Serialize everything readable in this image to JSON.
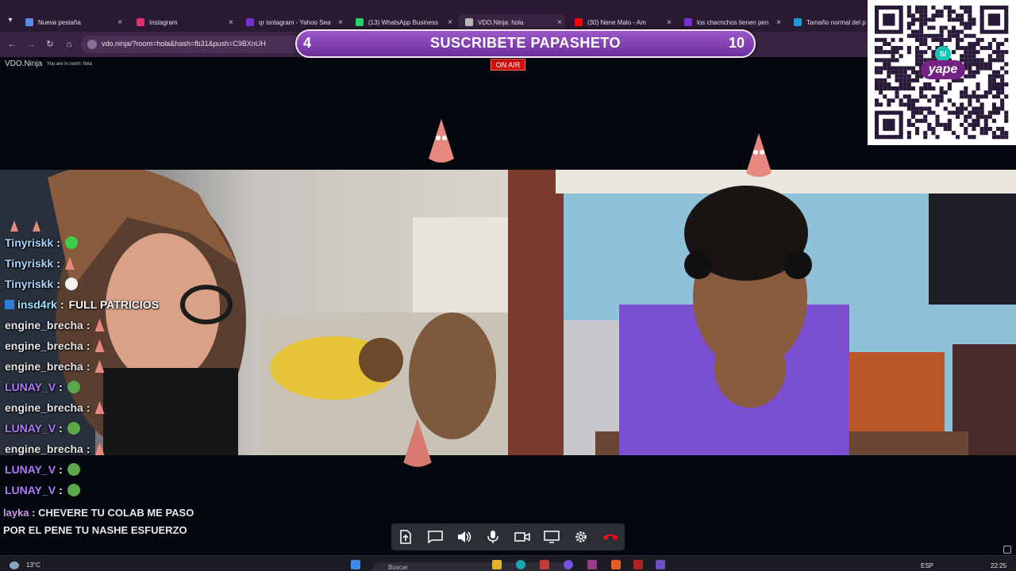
{
  "browser": {
    "tabs": [
      {
        "label": "Nueva pestaña",
        "favicon_color": "#5b8de6"
      },
      {
        "label": "Instagram",
        "favicon_color": "#e1306c"
      },
      {
        "label": "qr isntagram - Yahoo Sea",
        "favicon_color": "#7b2fd6"
      },
      {
        "label": "(13) WhatsApp Business",
        "favicon_color": "#25d366"
      },
      {
        "label": "VDO.Ninja: hola",
        "favicon_color": "#b8b8b8",
        "active": true
      },
      {
        "label": "(30) Nene Malo - Am",
        "favicon_color": "#ff0000"
      },
      {
        "label": "los chacnchos tienen pen",
        "favicon_color": "#7b2fd6"
      },
      {
        "label": "Tamaño normal del p",
        "favicon_color": "#1e9bd6"
      }
    ],
    "url": "vdo.ninja/?room=hola&hash=fb31&push=C9BXnUH"
  },
  "banner": {
    "left_number": "4",
    "text": "SUSCRIBETE PAPASHETO",
    "right_number": "10"
  },
  "header": {
    "brand": "VDO.Ninja",
    "room_note": "You are in room: hola",
    "on_air": "ON AIR"
  },
  "qr": {
    "badge": "yape",
    "badge_symbol": "S/"
  },
  "chat": {
    "messages": [
      {
        "user": "Tinyriskk",
        "text": "",
        "emote": "pepe",
        "color": "#a8d6ff"
      },
      {
        "user": "Tinyriskk",
        "text": "",
        "emote": "patrick",
        "color": "#a8d6ff"
      },
      {
        "user": "Tinyriskk",
        "text": "",
        "emote": "skull",
        "color": "#a8d6ff"
      },
      {
        "user": "insd4rk",
        "text": "FULL PATRICIOS",
        "emote": "",
        "color": "#9be3ff",
        "badge": true
      },
      {
        "user": "engine_brecha",
        "text": "",
        "emote": "patrick",
        "color": "#e6e6e6"
      },
      {
        "user": "engine_brecha",
        "text": "",
        "emote": "patrick",
        "color": "#e6e6e6"
      },
      {
        "user": "engine_brecha",
        "text": "",
        "emote": "patrick",
        "color": "#e6e6e6"
      },
      {
        "user": "LUNAY_V",
        "text": "",
        "emote": "frog",
        "color": "#b07cff"
      },
      {
        "user": "engine_brecha",
        "text": "",
        "emote": "patrick",
        "color": "#e6e6e6"
      },
      {
        "user": "LUNAY_V",
        "text": "",
        "emote": "frog",
        "color": "#b07cff"
      },
      {
        "user": "engine_brecha",
        "text": "",
        "emote": "patrick",
        "color": "#e6e6e6"
      },
      {
        "user": "LUNAY_V",
        "text": "",
        "emote": "frog",
        "color": "#b07cff"
      },
      {
        "user": "LUNAY_V",
        "text": "",
        "emote": "frog",
        "color": "#b07cff"
      }
    ],
    "last": {
      "user": "layka",
      "color": "#c89ae8",
      "text": "CHEVERE TU COLAB ME PASO POR EL PENE TU NASHE ESFUERZO"
    }
  },
  "controls": [
    {
      "name": "share-file-button",
      "icon": "file-upload-icon"
    },
    {
      "name": "chat-button",
      "icon": "chat-icon"
    },
    {
      "name": "speaker-button",
      "icon": "speaker-icon"
    },
    {
      "name": "microphone-button",
      "icon": "microphone-icon"
    },
    {
      "name": "camera-button",
      "icon": "camera-icon"
    },
    {
      "name": "screen-share-button",
      "icon": "screen-icon"
    },
    {
      "name": "settings-button",
      "icon": "gear-icon"
    },
    {
      "name": "hangup-button",
      "icon": "hangup-icon"
    }
  ],
  "taskbar": {
    "temperature": "13°C",
    "search_placeholder": "Buscar",
    "language": "ESP",
    "time": "22:25"
  }
}
